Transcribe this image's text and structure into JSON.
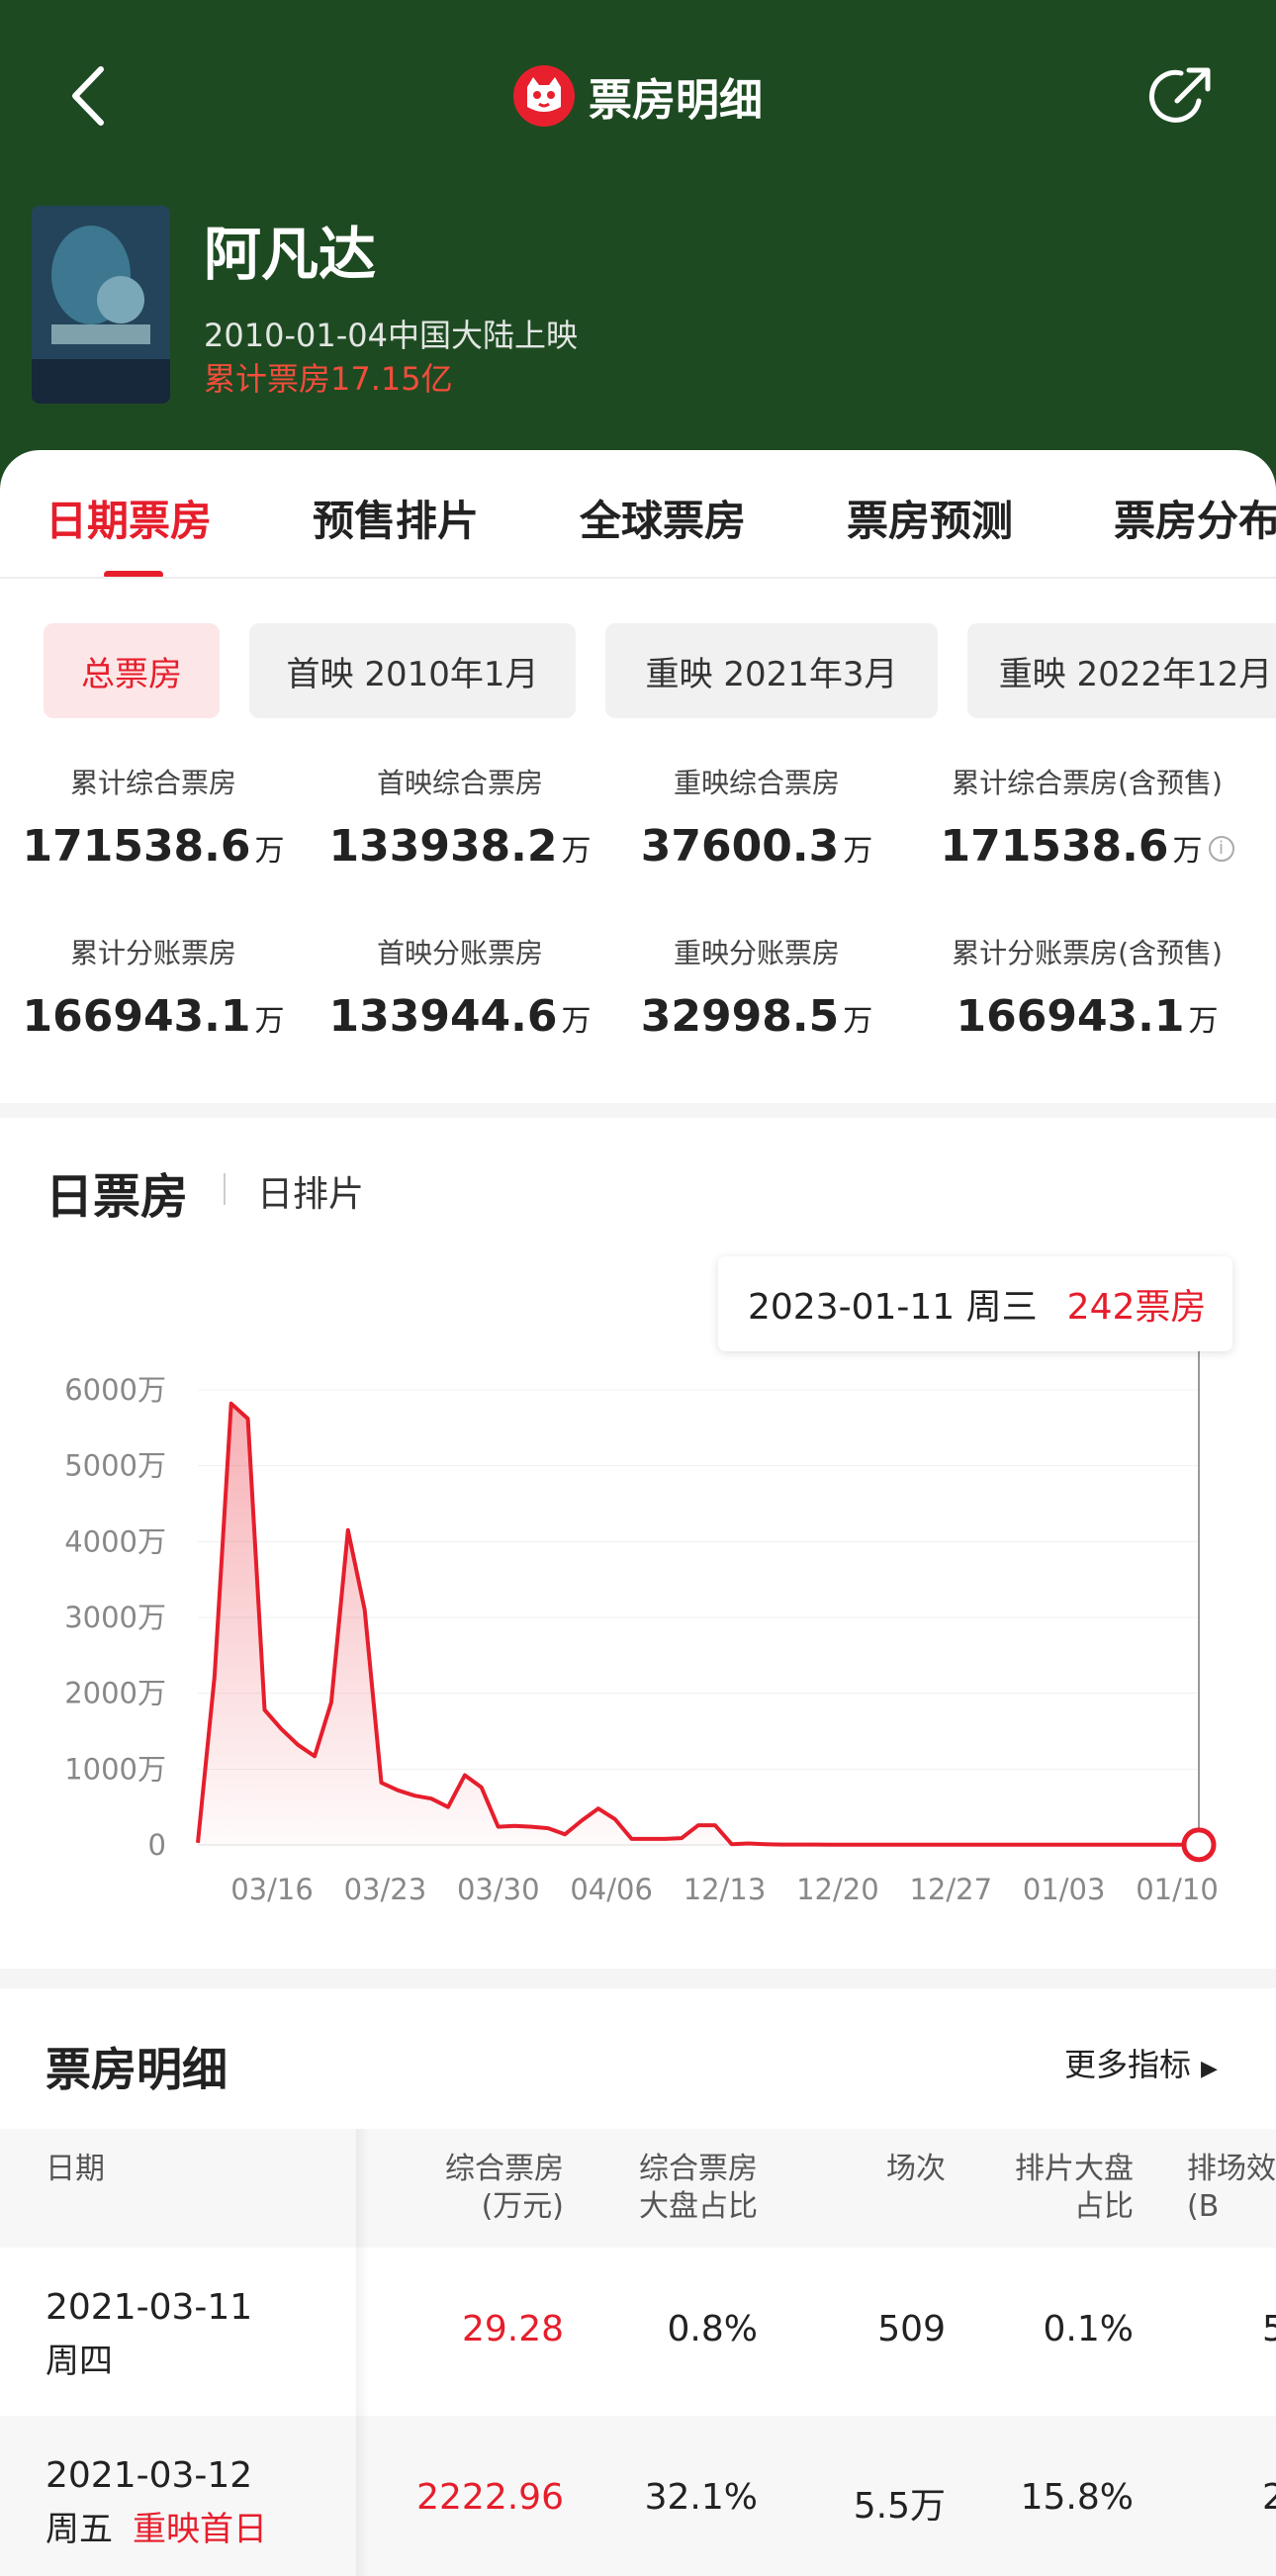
{
  "nav": {
    "title": "票房明细",
    "back_icon": "back-chevron-icon",
    "share_icon": "share-icon"
  },
  "movie": {
    "name": "阿凡达",
    "release": "2010-01-04中国大陆上映",
    "total": "累计票房17.15亿"
  },
  "tabs": [
    "日期票房",
    "预售排片",
    "全球票房",
    "票房预测",
    "票房分布"
  ],
  "chips": [
    "总票房",
    "首映 2010年1月",
    "重映 2021年3月",
    "重映 2022年12月"
  ],
  "stats": [
    {
      "label": "累计综合票房",
      "value": "171538.6",
      "unit": "万"
    },
    {
      "label": "首映综合票房",
      "value": "133938.2",
      "unit": "万"
    },
    {
      "label": "重映综合票房",
      "value": "37600.3",
      "unit": "万"
    },
    {
      "label": "累计综合票房(含预售)",
      "value": "171538.6",
      "unit": "万"
    },
    {
      "label": "累计分账票房",
      "value": "166943.1",
      "unit": "万"
    },
    {
      "label": "首映分账票房",
      "value": "133944.6",
      "unit": "万"
    },
    {
      "label": "重映分账票房",
      "value": "32998.5",
      "unit": "万"
    },
    {
      "label": "累计分账票房(含预售)",
      "value": "166943.1",
      "unit": "万"
    }
  ],
  "chart_section": {
    "title": "日票房",
    "sub": "日排片",
    "tooltip_date": "2023-01-11 周三",
    "tooltip_value": "242票房"
  },
  "chart_data": {
    "type": "area",
    "title": "",
    "xlabel": "",
    "ylabel": "",
    "ylim": [
      0,
      6000
    ],
    "y_ticks": [
      "6000万",
      "5000万",
      "4000万",
      "3000万",
      "2000万",
      "1000万",
      "0"
    ],
    "x_ticks": [
      "03/16",
      "03/23",
      "03/30",
      "04/06",
      "12/13",
      "12/20",
      "12/27",
      "01/03",
      "01/10"
    ],
    "series": [
      {
        "values": [
          29,
          2223,
          5820,
          5620,
          1780,
          1530,
          1320,
          1170,
          1880,
          4150,
          3100,
          820,
          720,
          650,
          610,
          500,
          920,
          760,
          240,
          250,
          240,
          220,
          140,
          320,
          480,
          340,
          80,
          80,
          80,
          90,
          260,
          260,
          10,
          20,
          10,
          5,
          5,
          5,
          3,
          3,
          3,
          3,
          3,
          3,
          3,
          3,
          3,
          3,
          3,
          3,
          3,
          3,
          3,
          3,
          3,
          3,
          3,
          3,
          3,
          3,
          2
        ]
      }
    ],
    "grid": true,
    "legend": "none",
    "color": "#e61e2c"
  },
  "table": {
    "title": "票房明细",
    "more": "更多指标",
    "headers": [
      "日期",
      "综合票房\n(万元)",
      "综合票房\n大盘占比",
      "场次",
      "排片大盘\n占比",
      "排场效\n(B"
    ],
    "rows": [
      {
        "date": "2021-03-11",
        "weekday": "周四",
        "tag": "",
        "box": "29.28",
        "share": "0.8%",
        "shows": "509",
        "ratio": "0.1%",
        "eff": "5"
      },
      {
        "date": "2021-03-12",
        "weekday": "周五",
        "tag": "重映首日",
        "box": "2222.96",
        "share": "32.1%",
        "shows": "5.5万",
        "ratio": "15.8%",
        "eff": "2"
      }
    ]
  }
}
